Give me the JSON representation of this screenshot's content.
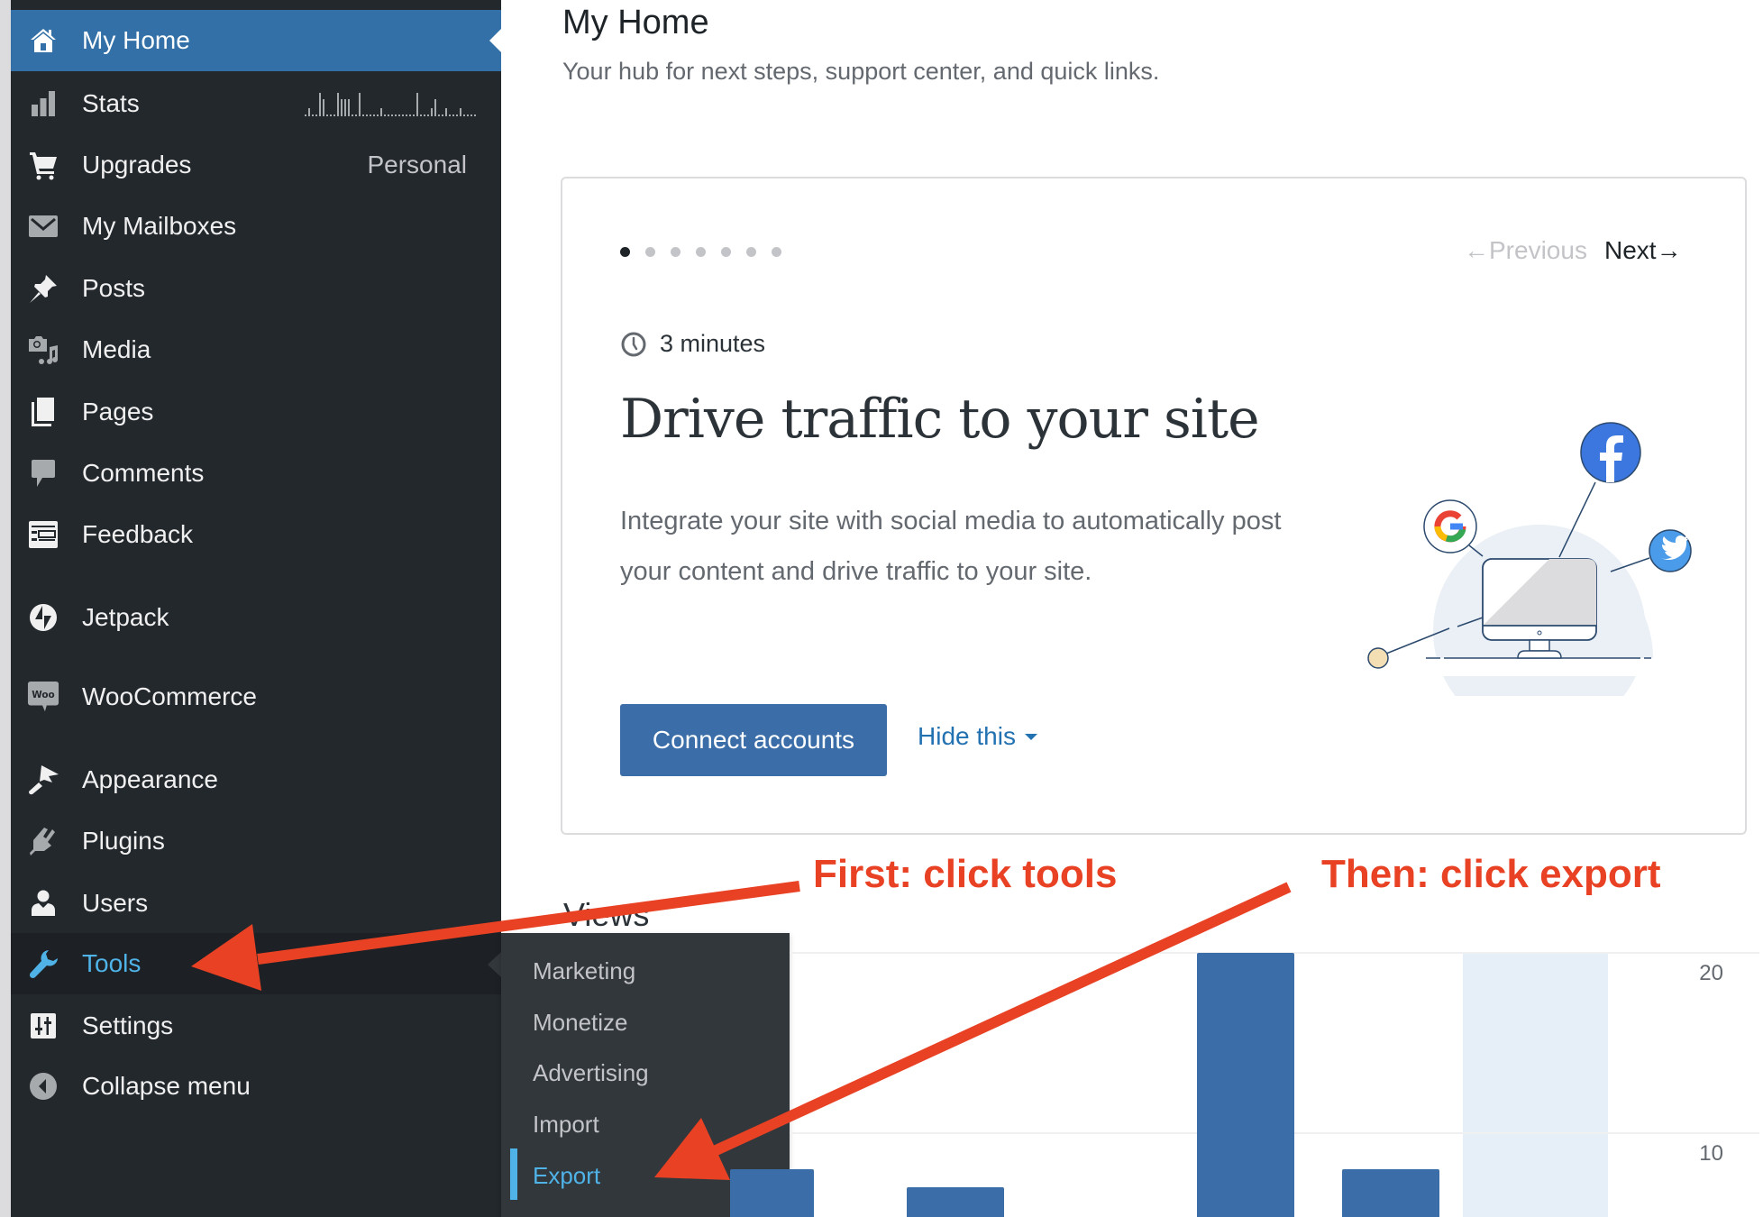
{
  "sidebar": {
    "items": [
      {
        "id": "my-home",
        "label": "My Home",
        "icon": "home-icon",
        "state": "active"
      },
      {
        "id": "stats",
        "label": "Stats",
        "icon": "stats-bar-icon",
        "sparkline": [
          0.2,
          1,
          0.2,
          0.2,
          3,
          2.2,
          0.2,
          0.2,
          0.2,
          3,
          2.2,
          2.2,
          2.2,
          0.2,
          0.2,
          3,
          0.2,
          0.2,
          0.2,
          0.2,
          0.2,
          1,
          0.2,
          0.2,
          0.2,
          0.2,
          0.2,
          0.2,
          0.2,
          0.2,
          0.2,
          3,
          0.2,
          0.2,
          0.2,
          1,
          2.2,
          0.2,
          0.2,
          1,
          0.2,
          0.2,
          0.2,
          1,
          0.2,
          0.2,
          0.2,
          0.2
        ]
      },
      {
        "id": "upgrades",
        "label": "Upgrades",
        "icon": "cart-icon",
        "badge": "Personal"
      },
      {
        "id": "my-mailboxes",
        "label": "My Mailboxes",
        "icon": "mail-icon"
      },
      {
        "id": "posts",
        "label": "Posts",
        "icon": "pin-icon"
      },
      {
        "id": "media",
        "label": "Media",
        "icon": "media-icon"
      },
      {
        "id": "pages",
        "label": "Pages",
        "icon": "pages-icon"
      },
      {
        "id": "comments",
        "label": "Comments",
        "icon": "comment-icon"
      },
      {
        "id": "feedback",
        "label": "Feedback",
        "icon": "feedback-icon"
      },
      {
        "id": "jetpack",
        "label": "Jetpack",
        "icon": "jetpack-icon"
      },
      {
        "id": "woocommerce",
        "label": "WooCommerce",
        "icon": "woo-icon",
        "icon_text": "Woo"
      },
      {
        "id": "appearance",
        "label": "Appearance",
        "icon": "brush-icon"
      },
      {
        "id": "plugins",
        "label": "Plugins",
        "icon": "plug-icon"
      },
      {
        "id": "users",
        "label": "Users",
        "icon": "user-icon"
      },
      {
        "id": "tools",
        "label": "Tools",
        "icon": "wrench-icon",
        "state": "current"
      },
      {
        "id": "settings",
        "label": "Settings",
        "icon": "settings-icon"
      },
      {
        "id": "collapse-menu",
        "label": "Collapse menu",
        "icon": "collapse-arrow-icon"
      }
    ],
    "submenu": {
      "items": [
        {
          "label": "Marketing"
        },
        {
          "label": "Monetize"
        },
        {
          "label": "Advertising"
        },
        {
          "label": "Import"
        },
        {
          "label": "Export",
          "state": "current"
        }
      ]
    }
  },
  "header": {
    "title": "My Home",
    "subtitle": "Your hub for next steps, support center, and quick links."
  },
  "task_card": {
    "pager_total": 7,
    "pager_current": 1,
    "prev_label": "Previous",
    "next_label": "Next",
    "time_estimate": "3 minutes",
    "title": "Drive traffic to your site",
    "description": "Integrate your site with social media to automatically post your content and drive traffic to your site.",
    "primary_button": "Connect accounts",
    "secondary_button": "Hide this",
    "illustration_icons": [
      "google-icon",
      "facebook-icon",
      "twitter-icon"
    ]
  },
  "views": {
    "title": "Views"
  },
  "chart_data": {
    "type": "bar",
    "title": "Views",
    "xlabel": "",
    "ylabel": "",
    "y_ticks": [
      10,
      20
    ],
    "ylim_visible": [
      6,
      21
    ],
    "grid": true,
    "axis_position": "right",
    "bars": [
      {
        "value": 8
      },
      {
        "value": 7
      },
      {
        "value": 20
      },
      {
        "value": 8
      },
      {
        "value": null,
        "highlighted": true
      }
    ],
    "colors": {
      "bar": "#3b6ea8",
      "highlight": "#e6eef7",
      "grid": "#f0f0f1",
      "tick": "#646970"
    }
  },
  "annotations": {
    "first": "First: click tools",
    "then": "Then: click export",
    "color": "#e84124"
  },
  "colors": {
    "sidebar_bg": "#23282d",
    "active_bg": "#3270a7",
    "current_text": "#4fb3e8",
    "primary_button": "#3b6ea8",
    "link": "#2271b1"
  }
}
